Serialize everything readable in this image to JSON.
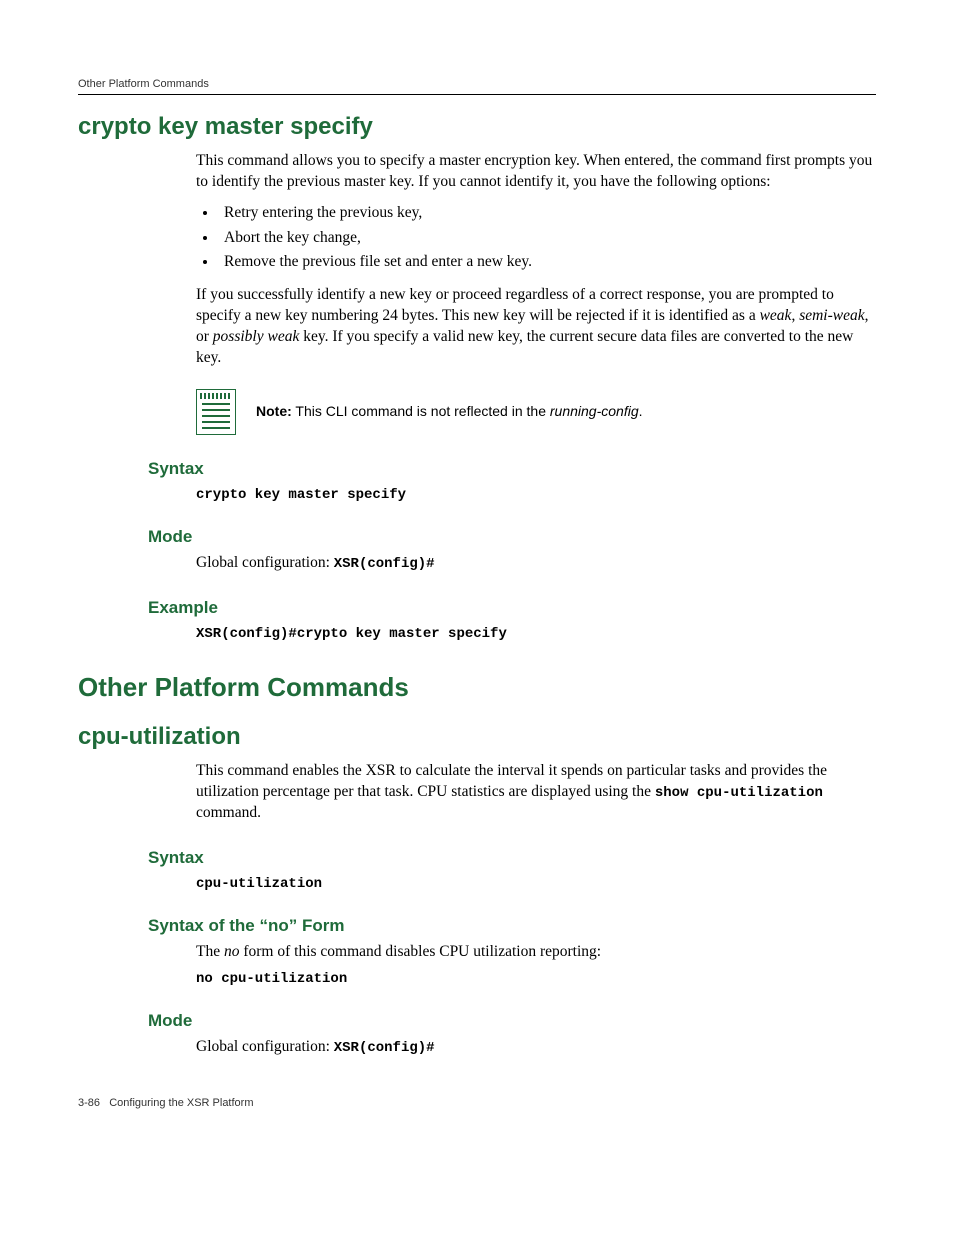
{
  "runningHeader": "Other Platform Commands",
  "sec1": {
    "title": "crypto key master specify",
    "intro": "This command allows you to specify a master encryption key. When entered, the command first prompts you to identify the previous master key. If you cannot identify it, you have the following options:",
    "bullets": [
      "Retry entering the previous key,",
      "Abort the key change,",
      "Remove the previous file set and enter a new key."
    ],
    "para2_a": "If you successfully identify a new key or proceed regardless of a correct response, you are prompted to specify a new key numbering 24 bytes. This new key will be rejected if it is identified as a ",
    "para2_weak": "weak",
    "para2_b": ", ",
    "para2_semiweak": "semi-weak",
    "para2_c": ", or ",
    "para2_possibly": "possibly weak",
    "para2_d": " key. If you specify a valid new key, the current secure data files are converted to the new key.",
    "note_prefix": "Note:",
    "note_a": " This CLI command is not reflected in the ",
    "note_em": "running-config",
    "note_b": ".",
    "syntaxHead": "Syntax",
    "syntaxCode": "crypto key master specify",
    "modeHead": "Mode",
    "modeText": "Global configuration: ",
    "modeCode": "XSR(config)#",
    "exampleHead": "Example",
    "exampleCode": "XSR(config)#crypto key master specify"
  },
  "sec2Title": "Other Platform Commands",
  "sec3": {
    "title": "cpu-utilization",
    "intro_a": "This command enables the XSR to calculate the interval it spends on particular tasks and provides the utilization percentage per that task. CPU statistics are displayed using the ",
    "intro_code": "show cpu-utilization",
    "intro_b": " command.",
    "syntaxHead": "Syntax",
    "syntaxCode": "cpu-utilization",
    "noFormHead": "Syntax of the “no” Form",
    "noFormText_a": "The ",
    "noFormText_em": "no",
    "noFormText_b": " form of this command disables CPU utilization reporting:",
    "noFormCode": "no cpu-utilization",
    "modeHead": "Mode",
    "modeText": "Global configuration: ",
    "modeCode": "XSR(config)#"
  },
  "footer": {
    "pageNum": "3-86",
    "title": "Configuring the XSR Platform"
  }
}
